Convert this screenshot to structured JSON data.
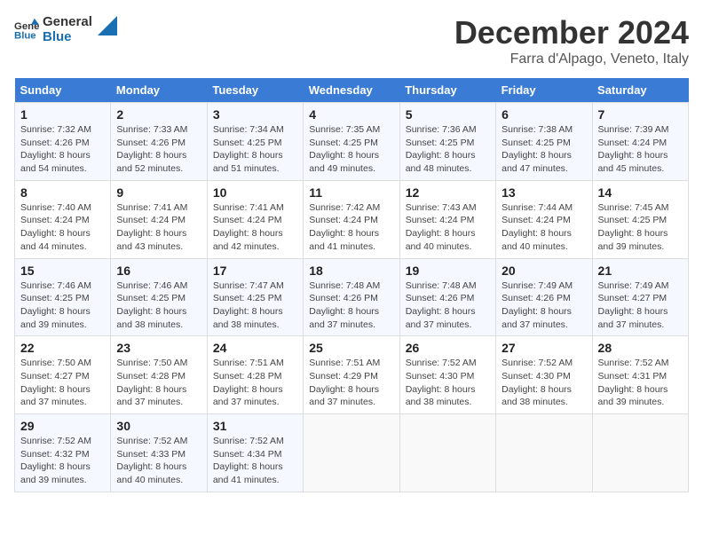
{
  "header": {
    "logo_line1": "General",
    "logo_line2": "Blue",
    "month": "December 2024",
    "location": "Farra d'Alpago, Veneto, Italy"
  },
  "days_of_week": [
    "Sunday",
    "Monday",
    "Tuesday",
    "Wednesday",
    "Thursday",
    "Friday",
    "Saturday"
  ],
  "weeks": [
    [
      {
        "day": "1",
        "sunrise": "7:32 AM",
        "sunset": "4:26 PM",
        "daylight": "8 hours and 54 minutes."
      },
      {
        "day": "2",
        "sunrise": "7:33 AM",
        "sunset": "4:26 PM",
        "daylight": "8 hours and 52 minutes."
      },
      {
        "day": "3",
        "sunrise": "7:34 AM",
        "sunset": "4:25 PM",
        "daylight": "8 hours and 51 minutes."
      },
      {
        "day": "4",
        "sunrise": "7:35 AM",
        "sunset": "4:25 PM",
        "daylight": "8 hours and 49 minutes."
      },
      {
        "day": "5",
        "sunrise": "7:36 AM",
        "sunset": "4:25 PM",
        "daylight": "8 hours and 48 minutes."
      },
      {
        "day": "6",
        "sunrise": "7:38 AM",
        "sunset": "4:25 PM",
        "daylight": "8 hours and 47 minutes."
      },
      {
        "day": "7",
        "sunrise": "7:39 AM",
        "sunset": "4:24 PM",
        "daylight": "8 hours and 45 minutes."
      }
    ],
    [
      {
        "day": "8",
        "sunrise": "7:40 AM",
        "sunset": "4:24 PM",
        "daylight": "8 hours and 44 minutes."
      },
      {
        "day": "9",
        "sunrise": "7:41 AM",
        "sunset": "4:24 PM",
        "daylight": "8 hours and 43 minutes."
      },
      {
        "day": "10",
        "sunrise": "7:41 AM",
        "sunset": "4:24 PM",
        "daylight": "8 hours and 42 minutes."
      },
      {
        "day": "11",
        "sunrise": "7:42 AM",
        "sunset": "4:24 PM",
        "daylight": "8 hours and 41 minutes."
      },
      {
        "day": "12",
        "sunrise": "7:43 AM",
        "sunset": "4:24 PM",
        "daylight": "8 hours and 40 minutes."
      },
      {
        "day": "13",
        "sunrise": "7:44 AM",
        "sunset": "4:24 PM",
        "daylight": "8 hours and 40 minutes."
      },
      {
        "day": "14",
        "sunrise": "7:45 AM",
        "sunset": "4:25 PM",
        "daylight": "8 hours and 39 minutes."
      }
    ],
    [
      {
        "day": "15",
        "sunrise": "7:46 AM",
        "sunset": "4:25 PM",
        "daylight": "8 hours and 39 minutes."
      },
      {
        "day": "16",
        "sunrise": "7:46 AM",
        "sunset": "4:25 PM",
        "daylight": "8 hours and 38 minutes."
      },
      {
        "day": "17",
        "sunrise": "7:47 AM",
        "sunset": "4:25 PM",
        "daylight": "8 hours and 38 minutes."
      },
      {
        "day": "18",
        "sunrise": "7:48 AM",
        "sunset": "4:26 PM",
        "daylight": "8 hours and 37 minutes."
      },
      {
        "day": "19",
        "sunrise": "7:48 AM",
        "sunset": "4:26 PM",
        "daylight": "8 hours and 37 minutes."
      },
      {
        "day": "20",
        "sunrise": "7:49 AM",
        "sunset": "4:26 PM",
        "daylight": "8 hours and 37 minutes."
      },
      {
        "day": "21",
        "sunrise": "7:49 AM",
        "sunset": "4:27 PM",
        "daylight": "8 hours and 37 minutes."
      }
    ],
    [
      {
        "day": "22",
        "sunrise": "7:50 AM",
        "sunset": "4:27 PM",
        "daylight": "8 hours and 37 minutes."
      },
      {
        "day": "23",
        "sunrise": "7:50 AM",
        "sunset": "4:28 PM",
        "daylight": "8 hours and 37 minutes."
      },
      {
        "day": "24",
        "sunrise": "7:51 AM",
        "sunset": "4:28 PM",
        "daylight": "8 hours and 37 minutes."
      },
      {
        "day": "25",
        "sunrise": "7:51 AM",
        "sunset": "4:29 PM",
        "daylight": "8 hours and 37 minutes."
      },
      {
        "day": "26",
        "sunrise": "7:52 AM",
        "sunset": "4:30 PM",
        "daylight": "8 hours and 38 minutes."
      },
      {
        "day": "27",
        "sunrise": "7:52 AM",
        "sunset": "4:30 PM",
        "daylight": "8 hours and 38 minutes."
      },
      {
        "day": "28",
        "sunrise": "7:52 AM",
        "sunset": "4:31 PM",
        "daylight": "8 hours and 39 minutes."
      }
    ],
    [
      {
        "day": "29",
        "sunrise": "7:52 AM",
        "sunset": "4:32 PM",
        "daylight": "8 hours and 39 minutes."
      },
      {
        "day": "30",
        "sunrise": "7:52 AM",
        "sunset": "4:33 PM",
        "daylight": "8 hours and 40 minutes."
      },
      {
        "day": "31",
        "sunrise": "7:52 AM",
        "sunset": "4:34 PM",
        "daylight": "8 hours and 41 minutes."
      },
      null,
      null,
      null,
      null
    ]
  ],
  "labels": {
    "sunrise": "Sunrise:",
    "sunset": "Sunset:",
    "daylight": "Daylight:"
  }
}
